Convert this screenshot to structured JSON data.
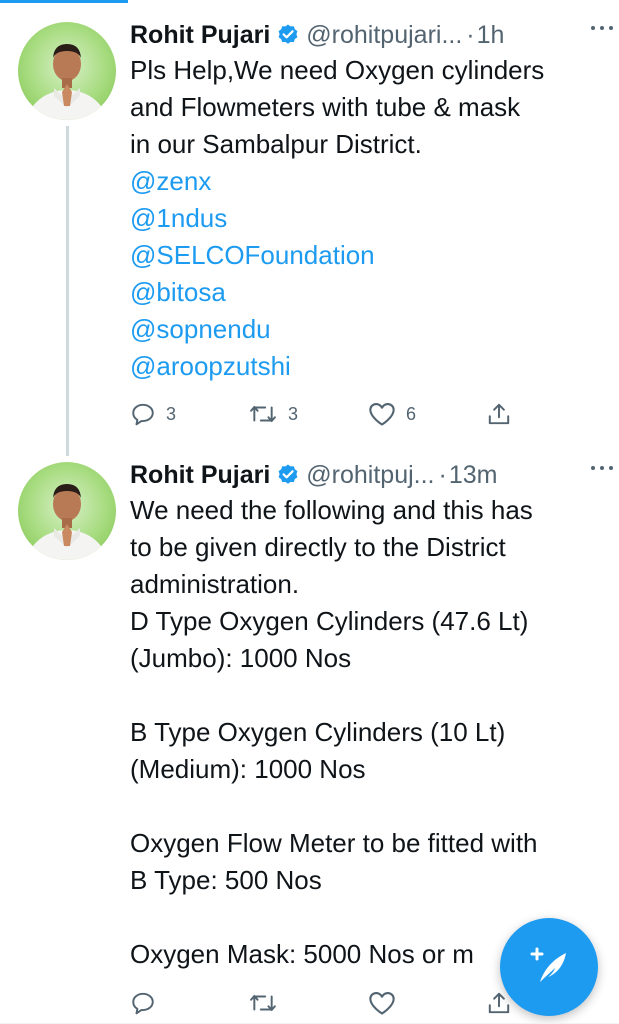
{
  "tweets": [
    {
      "author_name": "Rohit Pujari",
      "handle": "@rohitpujari...",
      "separator": "·",
      "time": "1h",
      "text_lines": [
        "Pls Help,We need Oxygen cylinders",
        "and Flowmeters with tube & mask",
        "in our Sambalpur District."
      ],
      "mentions": [
        "@zenx",
        "@1ndus",
        "@SELCOFoundation",
        "@bitosa",
        "@sopnendu",
        "@aroopzutshi"
      ],
      "replies": "3",
      "retweets": "3",
      "likes": "6"
    },
    {
      "author_name": "Rohit Pujari",
      "handle": "@rohitpuj...",
      "separator": "·",
      "time": "13m",
      "text_lines": [
        "We need the following and this has",
        "to be given directly to the District",
        "administration.",
        "D Type Oxygen Cylinders (47.6 Lt)",
        "(Jumbo): 1000 Nos",
        "",
        "B Type Oxygen Cylinders (10 Lt)",
        "(Medium): 1000 Nos",
        "",
        "Oxygen Flow Meter to be fitted with",
        "B Type: 500 Nos",
        "",
        "Oxygen Mask: 5000 Nos or m"
      ]
    }
  ],
  "colors": {
    "accent": "#1d9bf0",
    "text": "#0f1419",
    "muted": "#536471"
  },
  "icons": {
    "reply": "reply-icon",
    "retweet": "retweet-icon",
    "like": "heart-icon",
    "share": "share-icon",
    "compose": "compose-tweet-icon",
    "verified": "verified-badge-icon",
    "more": "more-options-icon"
  }
}
